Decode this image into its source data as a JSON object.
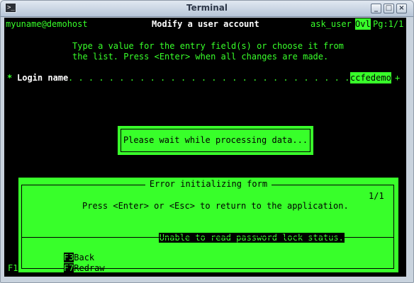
{
  "window": {
    "title": "Terminal",
    "app_icon_glyph": ">_",
    "buttons": {
      "minimize": "_",
      "maximize": "□",
      "close": "×"
    }
  },
  "header": {
    "user_host": "myuname@demohost",
    "screen_title": "Modify a user account",
    "command": "ask_user",
    "mode": "Ovl",
    "page": "Pg:1/1"
  },
  "instructions": {
    "line1": "Type a value for the entry field(s) or choose it from",
    "line2": "the list. Press <Enter> when all changes are made."
  },
  "form": {
    "required_marker": "*",
    "login_label": "Login name",
    "dots": ". . . . . . . . . . . . . . . . . . . . . . . . . . . . . . :",
    "login_value": "ccfedemo",
    "more_marker": "+"
  },
  "wait_dialog": {
    "message": "Please wait while processing data..."
  },
  "error_dialog": {
    "title": "Error initializing form",
    "page": "1/1",
    "instruction": "Press <Enter> or <Esc> to return to the application.",
    "error_message": "Unable to read password lock status.",
    "keys": [
      {
        "key": "F3",
        "label": "Back"
      },
      {
        "key": "F7",
        "label": "Redraw"
      }
    ]
  },
  "footer": {
    "left_key": "F1"
  },
  "colors": {
    "terminal_bg": "#000000",
    "terminal_fg": "#38ff2a"
  }
}
